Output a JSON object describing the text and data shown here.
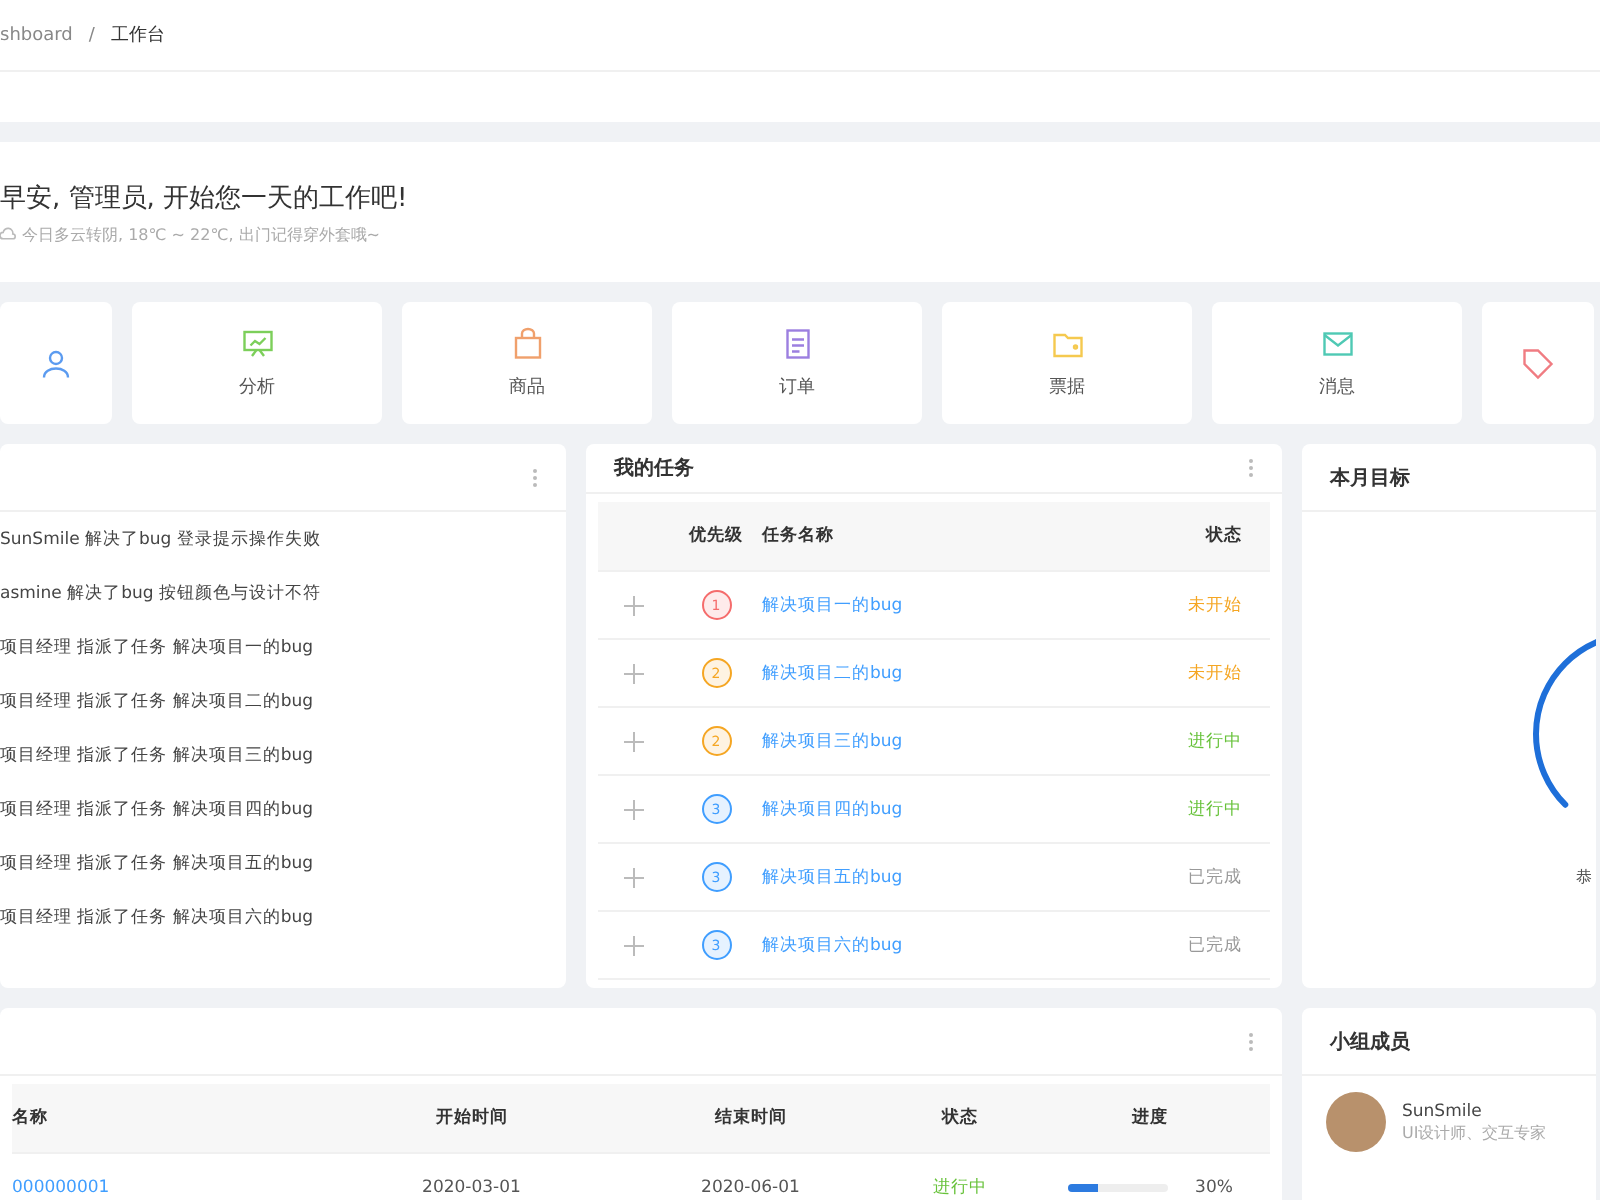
{
  "breadcrumb": {
    "items": [
      "shboard",
      "工作台"
    ],
    "separator": "/"
  },
  "welcome": {
    "title": "早安, 管理员, 开始您一天的工作吧!",
    "weather": "今日多云转阴, 18℃ ~ 22℃, 出门记得穿外套哦~"
  },
  "shortcuts": [
    {
      "kind": "user",
      "color": "#5b9bf0"
    },
    {
      "kind": "analysis",
      "label": "分析",
      "color": "#7ccf5a"
    },
    {
      "kind": "goods",
      "label": "商品",
      "color": "#f0a06c"
    },
    {
      "kind": "order",
      "label": "订单",
      "color": "#9c7fe0"
    },
    {
      "kind": "bill",
      "label": "票据",
      "color": "#f5c94f"
    },
    {
      "kind": "message",
      "label": "消息",
      "color": "#4fc9b4"
    },
    {
      "kind": "tag",
      "color": "#f07c82"
    }
  ],
  "activity": {
    "items": [
      "SunSmile 解决了bug 登录提示操作失败",
      "asmine 解决了bug 按钮颜色与设计不符",
      "项目经理 指派了任务 解决项目一的bug",
      "项目经理 指派了任务 解决项目二的bug",
      "项目经理 指派了任务 解决项目三的bug",
      "项目经理 指派了任务 解决项目四的bug",
      "项目经理 指派了任务 解决项目五的bug",
      "项目经理 指派了任务 解决项目六的bug"
    ]
  },
  "tasks": {
    "title": "我的任务",
    "columns": [
      "优先级",
      "任务名称",
      "状态"
    ],
    "rows": [
      {
        "priority": "1",
        "color": "#f56c6c",
        "name": "解决项目一的bug",
        "status": "未开始",
        "kind": "todo"
      },
      {
        "priority": "2",
        "color": "#f5a623",
        "name": "解决项目二的bug",
        "status": "未开始",
        "kind": "todo"
      },
      {
        "priority": "2",
        "color": "#f5a623",
        "name": "解决项目三的bug",
        "status": "进行中",
        "kind": "doing"
      },
      {
        "priority": "3",
        "color": "#409eff",
        "name": "解决项目四的bug",
        "status": "进行中",
        "kind": "doing"
      },
      {
        "priority": "3",
        "color": "#409eff",
        "name": "解决项目五的bug",
        "status": "已完成",
        "kind": "done"
      },
      {
        "priority": "3",
        "color": "#409eff",
        "name": "解决项目六的bug",
        "status": "已完成",
        "kind": "done"
      }
    ]
  },
  "goal": {
    "title": "本月目标",
    "caption": "恭"
  },
  "projects": {
    "columns": [
      "名称",
      "开始时间",
      "结束时间",
      "状态",
      "进度"
    ],
    "rows": [
      {
        "name": "000000001",
        "start": "2020-03-01",
        "end": "2020-06-01",
        "status": "进行中",
        "kind": "doing",
        "level": 0.3,
        "progress": "30%"
      }
    ]
  },
  "members": {
    "title": "小组成员",
    "items": [
      {
        "name": "SunSmile",
        "role": "UI设计师、交互专家"
      }
    ]
  }
}
